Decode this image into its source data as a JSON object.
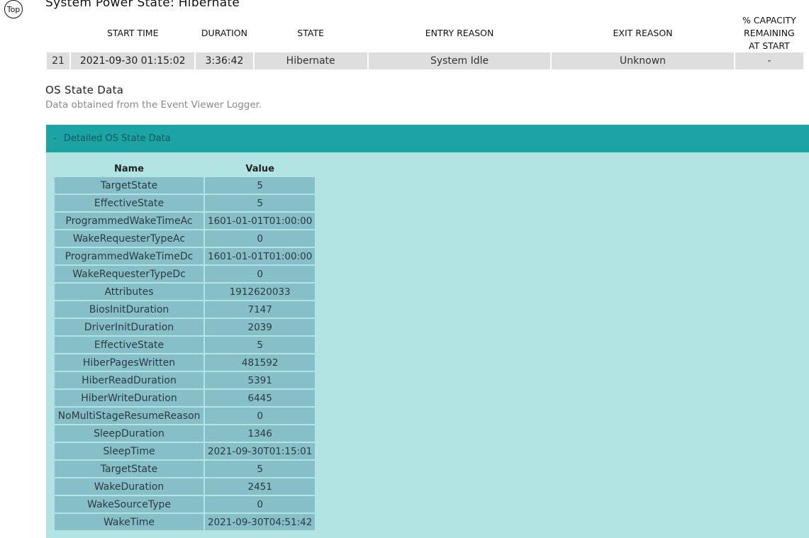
{
  "top_button": "Top",
  "section_title": "System Power State: Hibernate",
  "summary": {
    "headers": {
      "start_time": "START TIME",
      "duration": "DURATION",
      "state": "STATE",
      "entry_reason": "ENTRY REASON",
      "exit_reason": "EXIT REASON",
      "capacity_1": "% CAPACITY",
      "capacity_2": "REMAINING",
      "capacity_3": "AT START"
    },
    "row": {
      "index": "21",
      "start_time": "2021-09-30  01:15:02",
      "duration": "3:36:42",
      "state": "Hibernate",
      "entry_reason": "System Idle",
      "exit_reason": "Unknown",
      "capacity": "-"
    }
  },
  "os_state": {
    "title": "OS State Data",
    "description": "Data obtained from the Event Viewer Logger.",
    "panel_toggle": "-",
    "panel_title": "Detailed OS State Data",
    "columns": {
      "name": "Name",
      "value": "Value"
    },
    "rows": [
      {
        "name": "TargetState",
        "value": "5"
      },
      {
        "name": "EffectiveState",
        "value": "5"
      },
      {
        "name": "ProgrammedWakeTimeAc",
        "value": "1601-01-01T01:00:00"
      },
      {
        "name": "WakeRequesterTypeAc",
        "value": "0"
      },
      {
        "name": "ProgrammedWakeTimeDc",
        "value": "1601-01-01T01:00:00"
      },
      {
        "name": "WakeRequesterTypeDc",
        "value": "0"
      },
      {
        "name": "Attributes",
        "value": "1912620033"
      },
      {
        "name": "BiosInitDuration",
        "value": "7147"
      },
      {
        "name": "DriverInitDuration",
        "value": "2039"
      },
      {
        "name": "EffectiveState",
        "value": "5"
      },
      {
        "name": "HiberPagesWritten",
        "value": "481592"
      },
      {
        "name": "HiberReadDuration",
        "value": "5391"
      },
      {
        "name": "HiberWriteDuration",
        "value": "6445"
      },
      {
        "name": "NoMultiStageResumeReason",
        "value": "0"
      },
      {
        "name": "SleepDuration",
        "value": "1346"
      },
      {
        "name": "SleepTime",
        "value": "2021-09-30T01:15:01"
      },
      {
        "name": "TargetState",
        "value": "5"
      },
      {
        "name": "WakeDuration",
        "value": "2451"
      },
      {
        "name": "WakeSourceType",
        "value": "0"
      },
      {
        "name": "WakeTime",
        "value": "2021-09-30T04:51:42"
      }
    ]
  }
}
